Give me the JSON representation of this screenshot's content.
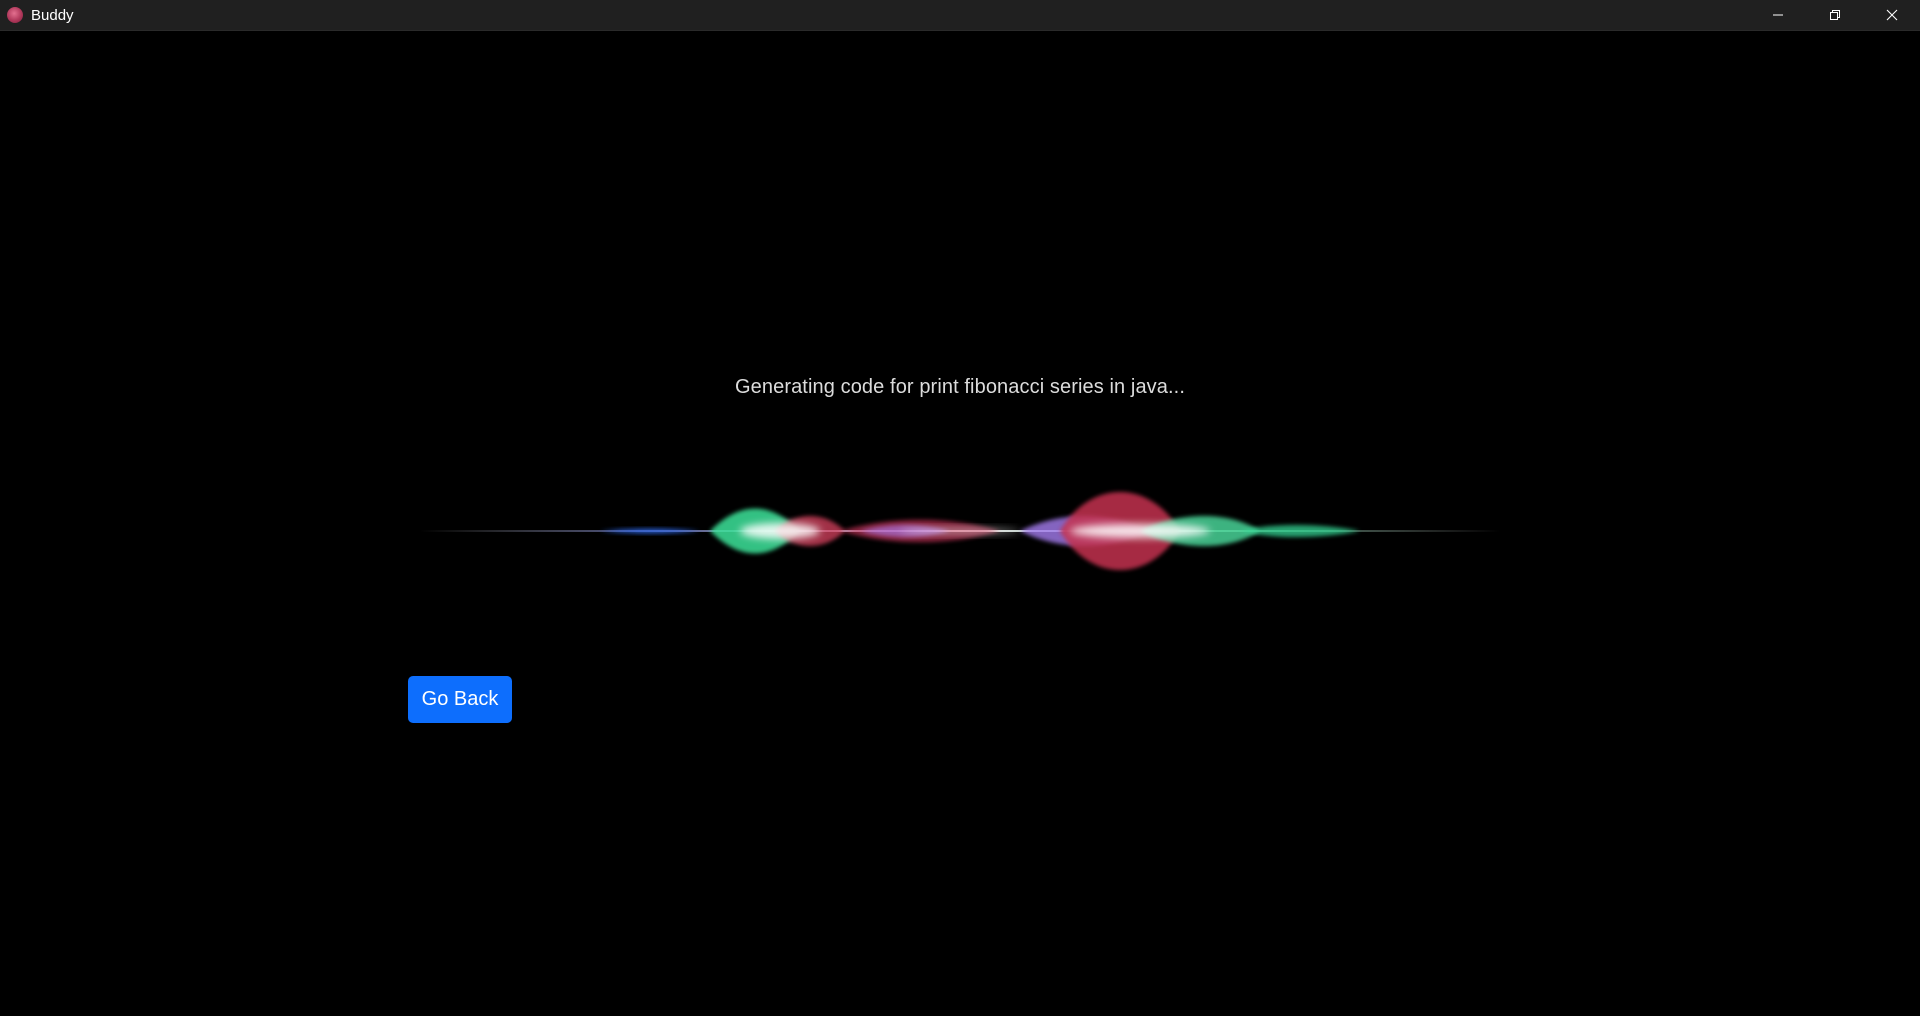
{
  "window": {
    "title": "Buddy",
    "app_icon": "buddy-app-icon",
    "controls": [
      {
        "name": "minimize",
        "icon": "minimize-icon"
      },
      {
        "name": "restore",
        "icon": "restore-icon"
      },
      {
        "name": "close",
        "icon": "close-icon"
      }
    ]
  },
  "main": {
    "status_text": "Generating code for print fibonacci series in java...",
    "waveform": {
      "icon": "voice-waveform-animation",
      "colors": [
        "#2f6df6",
        "#3ee39a",
        "#d8425f",
        "#b07ae8",
        "#ffffff"
      ]
    },
    "go_back_label": "Go Back"
  },
  "colors": {
    "background": "#000000",
    "titlebar": "#202020",
    "accent": "#0d6efd",
    "status_text": "#dcdcdc"
  }
}
